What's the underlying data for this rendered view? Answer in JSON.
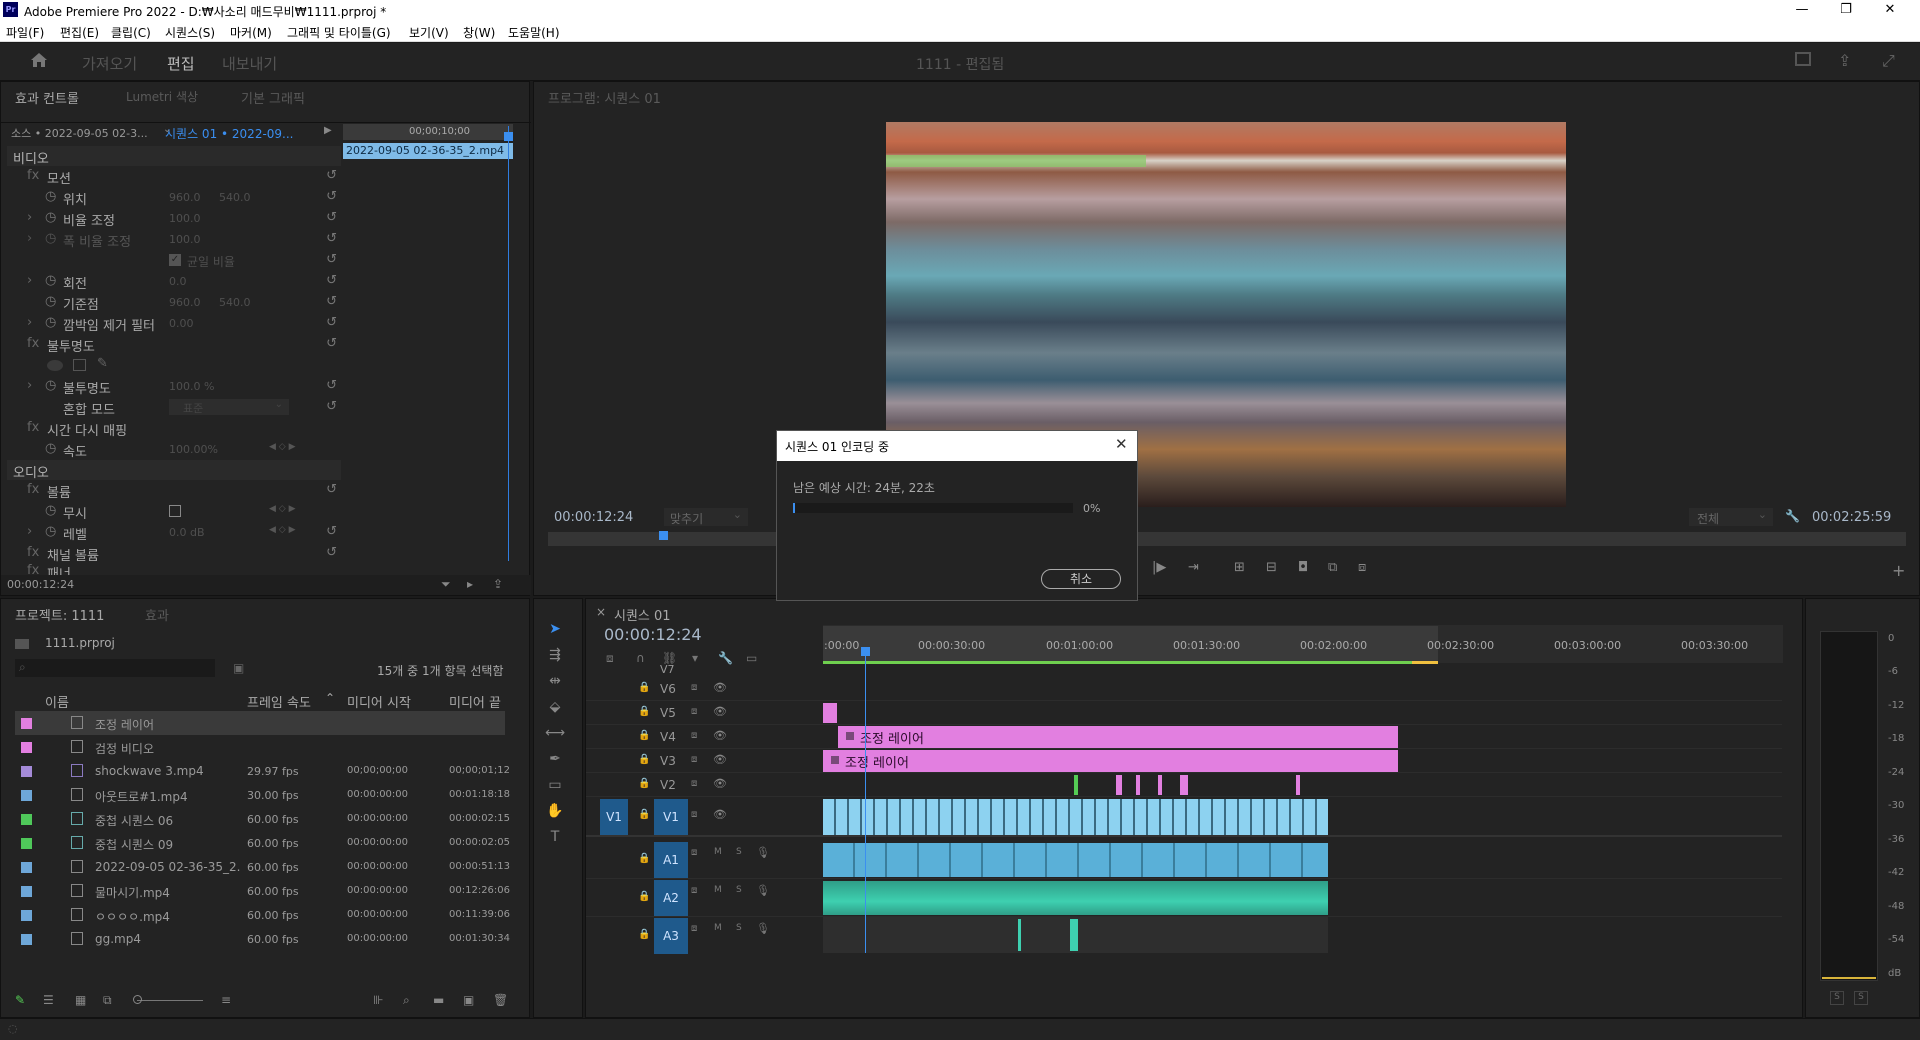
{
  "window": {
    "title": "Adobe Premiere Pro 2022 - D:₩사소리 매드무비₩1111.prproj *",
    "app_badge": "Pr",
    "minimize": "—",
    "maximize": "❐",
    "close": "✕"
  },
  "menu": [
    "파일(F)",
    "편집(E)",
    "클립(C)",
    "시퀀스(S)",
    "마커(M)",
    "그래픽 및 타이틀(G)",
    "보기(V)",
    "창(W)",
    "도움말(H)"
  ],
  "workspace": {
    "tabs": [
      "가져오기",
      "편집",
      "내보내기"
    ],
    "active": "편집",
    "center_title": "1111 - 편집됨"
  },
  "effect_controls": {
    "tabs": [
      "효과 컨트롤",
      "Lumetri 색상",
      "기본 그래픽"
    ],
    "source": "소스 • 2022-09-05 02-3...",
    "sequence": "시퀀스 01 • 2022-09...",
    "mini_timecode": "00;00;10;00",
    "clip_label": "2022-09-05 02-36-35_2.mp4",
    "video_header": "비디오",
    "motion": "모션",
    "position": {
      "label": "위치",
      "x": "960.0",
      "y": "540.0"
    },
    "scale": {
      "label": "비율 조정",
      "value": "100.0"
    },
    "scale_width": {
      "label": "폭 비율 조정",
      "value": "100.0"
    },
    "uniform_scale": "균일 비율",
    "rotation": {
      "label": "회전",
      "value": "0.0"
    },
    "anchor": {
      "label": "기준점",
      "x": "960.0",
      "y": "540.0"
    },
    "flicker": {
      "label": "깜박임 제거 필터",
      "value": "0.00"
    },
    "opacity_header": "불투명도",
    "opacity": {
      "label": "불투명도",
      "value": "100.0 %"
    },
    "blend": {
      "label": "혼합 모드",
      "value": "표준"
    },
    "time_remap": "시간 다시 매핑",
    "speed": {
      "label": "속도",
      "value": "100.00%"
    },
    "audio_header": "오디오",
    "volume_header": "볼륨",
    "bypass": "무시",
    "level": {
      "label": "레벨",
      "value": "0.0 dB"
    },
    "channel_volume": "채널 볼륨",
    "panner": "패너",
    "timecode": "00:00:12:24"
  },
  "program_monitor": {
    "title": "프로그램: 시퀀스 01",
    "timecode": "00:00:12:24",
    "fit": "맞추기",
    "resolution": "전체",
    "duration": "00:02:25:59"
  },
  "project": {
    "tabs": [
      "프로젝트: 1111",
      "효과"
    ],
    "file": "1111.prproj",
    "selection_info": "15개 중 1개 항목 선택함",
    "columns": [
      "이름",
      "프레임 속도",
      "미디어 시작",
      "미디어 끝"
    ],
    "items": [
      {
        "name": "조정 레이어",
        "fps": "",
        "start": "",
        "end": "",
        "color": "#e27fe0"
      },
      {
        "name": "검정 비디오",
        "fps": "",
        "start": "",
        "end": "",
        "color": "#e27fe0"
      },
      {
        "name": "shockwave 3.mp4",
        "fps": "29.97 fps",
        "start": "00;00;00;00",
        "end": "00;00;01;12",
        "color": "#a58bd8"
      },
      {
        "name": "아웃트로#1.mp4",
        "fps": "30.00 fps",
        "start": "00:00:00:00",
        "end": "00:01:18:18",
        "color": "#6ea7d8"
      },
      {
        "name": "중첩 시퀀스 06",
        "fps": "60.00 fps",
        "start": "00:00:00:00",
        "end": "00:00:02:15",
        "color": "#4fc85a"
      },
      {
        "name": "중첩 시퀀스 09",
        "fps": "60.00 fps",
        "start": "00:00:00:00",
        "end": "00:00:02:05",
        "color": "#4fc85a"
      },
      {
        "name": "2022-09-05 02-36-35_2.",
        "fps": "60.00 fps",
        "start": "00:00:00:00",
        "end": "00:00:51:13",
        "color": "#6ea7d8"
      },
      {
        "name": "물마시기.mp4",
        "fps": "60.00 fps",
        "start": "00:00:00:00",
        "end": "00:12:26:06",
        "color": "#6ea7d8"
      },
      {
        "name": "ㅇㅇㅇㅇ.mp4",
        "fps": "60.00 fps",
        "start": "00:00:00:00",
        "end": "00:11:39:06",
        "color": "#6ea7d8"
      },
      {
        "name": "gg.mp4",
        "fps": "60.00 fps",
        "start": "00:00:00:00",
        "end": "00:01:30:34",
        "color": "#6ea7d8"
      }
    ]
  },
  "timeline": {
    "title": "시퀀스 01",
    "timecode": "00:00:12:24",
    "ruler": [
      ":00:00",
      "00:00:30:00",
      "00:01:00:00",
      "00:01:30:00",
      "00:02:00:00",
      "00:02:30:00",
      "00:03:00:00",
      "00:03:30:00"
    ],
    "video_tracks": [
      "V7",
      "V6",
      "V5",
      "V4",
      "V3",
      "V2",
      "V1"
    ],
    "audio_tracks": [
      "A1",
      "A2",
      "A3"
    ],
    "source_patch": "V1",
    "adj_clip_v4": "조정 레이어",
    "adj_clip_v3": "조정 레이어",
    "track_m": "M",
    "track_s": "S",
    "clip_colors": {
      "adjustment": "#e27fe0",
      "video": "#8dd2f0",
      "audio": "#5ab0d8",
      "audio2": "#3ed0b0"
    }
  },
  "meter": {
    "labels": [
      "0",
      "-6",
      "-12",
      "-18",
      "-24",
      "-30",
      "-36",
      "-42",
      "-48",
      "-54",
      "dB"
    ],
    "solo": [
      "S",
      "S"
    ]
  },
  "dialog": {
    "title": "시퀀스 01 인코딩 중",
    "remaining": "남은 예상 시간: 24분, 22초",
    "progress_text": "0%",
    "progress": 0,
    "cancel": "취소"
  }
}
